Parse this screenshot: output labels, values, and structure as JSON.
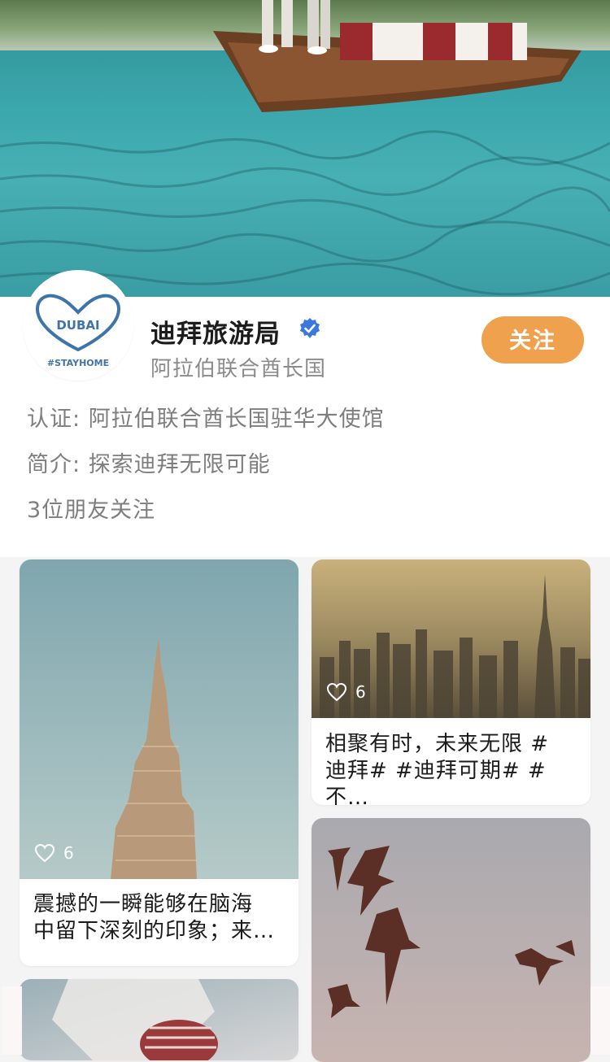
{
  "profile": {
    "name": "迪拜旅游局",
    "location": "阿拉伯联合酋长国",
    "follow_label": "关注",
    "avatar_brand": "DUBAI",
    "avatar_tagline": "#STAYHOME",
    "verification_label": "认证: ",
    "verification_value": "阿拉伯联合酋长国驻华大使馆",
    "bio_label": "简介: ",
    "bio_value": "探索迪拜无限可能",
    "friends_following": "3位朋友关注",
    "verified_icon": "verified-badge-icon",
    "colors": {
      "follow_button": "#f0a14e",
      "verified_badge": "#3a78e0"
    }
  },
  "feed": {
    "posts": [
      {
        "caption_line1": "震撼的一瞬能够在脑海",
        "caption_line2": "中留下深刻的印象；来…",
        "likes": "6",
        "image": "burj-khalifa"
      },
      {
        "caption_line1": "相聚有时，未来无限 #",
        "caption_line2": "迪拜# #迪拜可期# #不…",
        "likes": "6",
        "image": "dubai-skyline-sunset"
      },
      {
        "image": "flying-birds"
      },
      {
        "image": "woman-with-headscarf"
      }
    ],
    "like_icon": "heart-outline-icon"
  }
}
